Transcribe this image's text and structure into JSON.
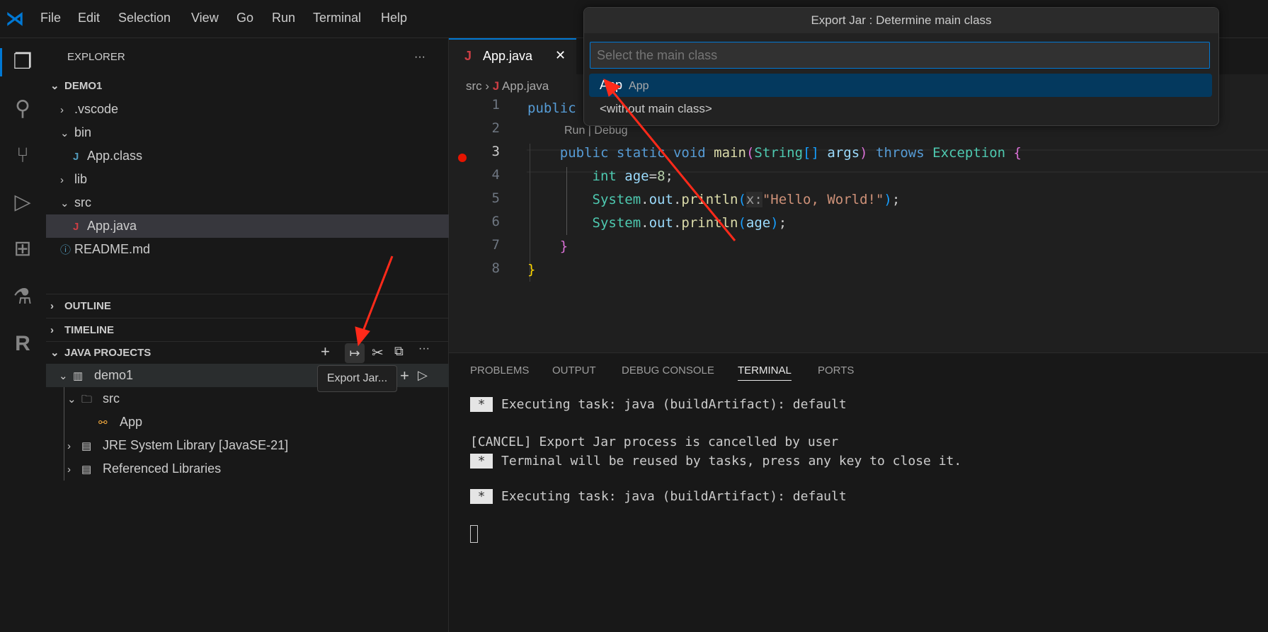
{
  "menu": [
    "File",
    "Edit",
    "Selection",
    "View",
    "Go",
    "Run",
    "Terminal",
    "Help"
  ],
  "activity_icons": [
    "files-icon",
    "search-icon",
    "source-control-icon",
    "run-debug-icon",
    "extensions-icon",
    "testing-icon",
    "r-icon"
  ],
  "explorer": {
    "title": "EXPLORER",
    "more": "···",
    "root": "DEMO1",
    "items": [
      {
        "label": ".vscode",
        "type": "folder-collapsed"
      },
      {
        "label": "bin",
        "type": "folder-open"
      },
      {
        "label": "App.class",
        "type": "java"
      },
      {
        "label": "lib",
        "type": "folder-collapsed"
      },
      {
        "label": "src",
        "type": "folder-open"
      },
      {
        "label": "App.java",
        "type": "java",
        "selected": true
      },
      {
        "label": "README.md",
        "type": "info"
      }
    ]
  },
  "sections": {
    "outline": "OUTLINE",
    "timeline": "TIMELINE",
    "java_projects": "JAVA PROJECTS"
  },
  "java_projects": {
    "project": "demo1",
    "src": "src",
    "app": "App",
    "jre": "JRE System Library [JavaSE-21]",
    "ref": "Referenced Libraries",
    "tooltip": "Export Jar..."
  },
  "editor": {
    "tab": "App.java",
    "tab_close": "✕",
    "breadcrumb": {
      "folder": "src",
      "file": "App.java"
    },
    "codelens": "Run | Debug",
    "line_numbers": [
      "1",
      "2",
      "3",
      "4",
      "5",
      "6",
      "7",
      "8"
    ]
  },
  "panel": {
    "tabs": [
      "PROBLEMS",
      "OUTPUT",
      "DEBUG CONSOLE",
      "TERMINAL",
      "PORTS"
    ],
    "active": "TERMINAL",
    "lines": [
      {
        "star": "*",
        "text": "Executing task: java (buildArtifact): default"
      },
      {
        "star": "",
        "text": "[CANCEL] Export Jar process is cancelled by user"
      },
      {
        "star": "*",
        "text": "Terminal will be reused by tasks, press any key to close it."
      },
      {
        "star": "*",
        "text": "Executing task: java (buildArtifact): default"
      }
    ]
  },
  "dialog": {
    "title": "Export Jar : Determine main class",
    "placeholder": "Select the main class",
    "items": [
      {
        "label": "App",
        "desc": "App"
      },
      {
        "label": "<without main class>",
        "desc": ""
      }
    ]
  },
  "colors": {
    "accent": "#0078d4",
    "selection": "#04395e",
    "breakpoint": "#e51400",
    "annotation": "#ff2a1a"
  }
}
